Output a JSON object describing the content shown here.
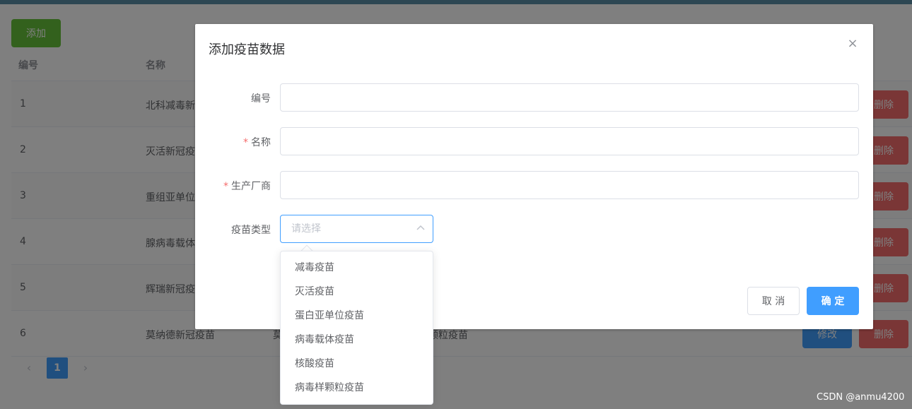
{
  "toolbar": {
    "add_label": "添加"
  },
  "table": {
    "headers": {
      "id": "编号",
      "name": "名称"
    },
    "rows": [
      {
        "id": "1",
        "name": "北科减毒新"
      },
      {
        "id": "2",
        "name": "灭活新冠疫"
      },
      {
        "id": "3",
        "name": "重组亚单位"
      },
      {
        "id": "4",
        "name": "腺病毒载体"
      },
      {
        "id": "5",
        "name": "辉瑞新冠疫"
      },
      {
        "id": "6",
        "name": "莫纳德新冠疫苗",
        "maker": "莫",
        "type": "颗粒疫苗"
      }
    ],
    "edit_label": "修改",
    "delete_label": "删除"
  },
  "pagination": {
    "current": "1",
    "prev": "‹",
    "next": "›"
  },
  "dialog": {
    "title": "添加疫苗数据",
    "close_icon": "×",
    "fields": {
      "id_label": "编号",
      "name_label": "名称",
      "maker_label": "生产厂商",
      "type_label": "疫苗类型",
      "required_mark": "*",
      "type_placeholder": "请选择"
    },
    "cancel_label": "取 消",
    "ok_label": "确 定"
  },
  "dropdown": {
    "options": [
      "减毒疫苗",
      "灭活疫苗",
      "蛋白亚单位疫苗",
      "病毒载体疫苗",
      "核酸疫苗",
      "病毒样颗粒疫苗"
    ]
  },
  "watermark": "CSDN @anmu4200",
  "colors": {
    "primary": "#409eff",
    "success": "#67c23a",
    "danger": "#f56c6c"
  }
}
